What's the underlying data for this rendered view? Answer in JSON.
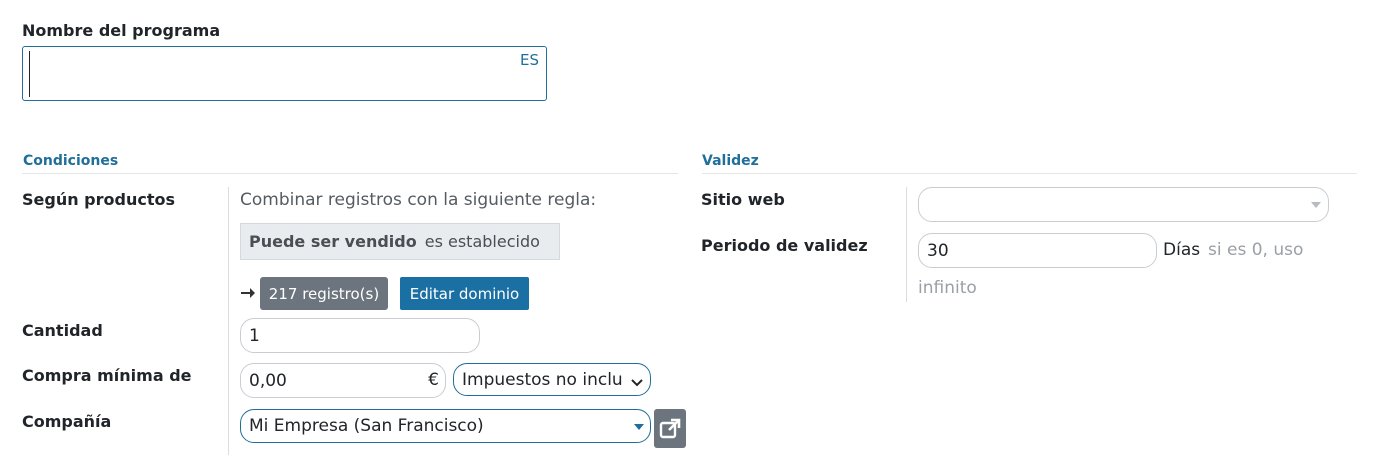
{
  "program": {
    "name_label": "Nombre del programa",
    "name_value": "",
    "lang_code": "ES"
  },
  "conditions": {
    "section_title": "Condiciones",
    "products": {
      "label": "Según productos",
      "rule_text": "Combinar registros con la siguiente regla:",
      "rule_field": "Puede ser vendido",
      "rule_operator": "es establecido",
      "records_button": "217 registro(s)",
      "edit_domain_button": "Editar dominio"
    },
    "quantity": {
      "label": "Cantidad",
      "value": "1"
    },
    "min_purchase": {
      "label": "Compra mínima de",
      "value": "0,00",
      "currency": "€",
      "tax_option": "Impuestos no inclu"
    },
    "company": {
      "label": "Compañía",
      "value": "Mi Empresa (San Francisco)"
    }
  },
  "validity": {
    "section_title": "Validez",
    "website": {
      "label": "Sitio web",
      "value": ""
    },
    "period": {
      "label": "Periodo de validez",
      "value": "30",
      "unit": "Días",
      "hint_line1": "si es 0, uso",
      "hint_line2": "infinito"
    }
  },
  "icons": {
    "arrow": "arrow-right-icon",
    "external": "external-link-icon",
    "dropdown": "caret-down-icon"
  },
  "colors": {
    "accent": "#1f6f9a",
    "primary_button": "#1a6fa3",
    "secondary_button": "#6c757d"
  }
}
